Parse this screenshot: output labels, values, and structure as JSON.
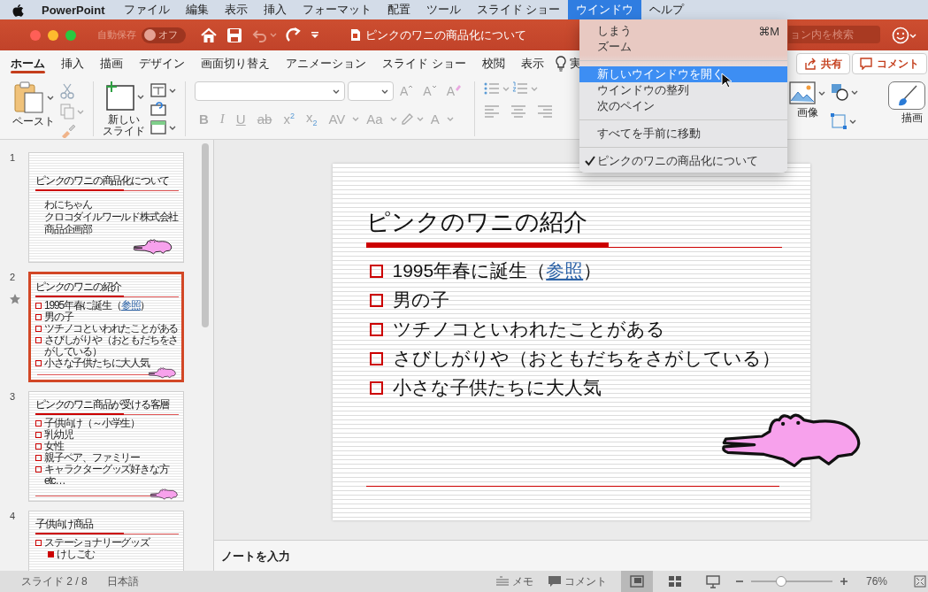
{
  "menubar": {
    "app_name": "PowerPoint",
    "menus": [
      {
        "label": "ファイル",
        "selected": false
      },
      {
        "label": "編集",
        "selected": false
      },
      {
        "label": "表示",
        "selected": false
      },
      {
        "label": "挿入",
        "selected": false
      },
      {
        "label": "フォーマット",
        "selected": false
      },
      {
        "label": "配置",
        "selected": false
      },
      {
        "label": "ツール",
        "selected": false
      },
      {
        "label": "スライド ショー",
        "selected": false
      },
      {
        "label": "ウインドウ",
        "selected": true
      },
      {
        "label": "ヘルプ",
        "selected": false
      }
    ]
  },
  "titlebar": {
    "autosave_label": "自動保存",
    "autosave_toggle": {
      "label": "オフ",
      "on": false
    },
    "document_title": "ピンクのワニの商品化について",
    "search": {
      "placeholder": "ョン内を検索"
    }
  },
  "ribbon_tabs": [
    {
      "label": "ホーム",
      "selected": true
    },
    {
      "label": "挿入",
      "selected": false
    },
    {
      "label": "描画",
      "selected": false
    },
    {
      "label": "デザイン",
      "selected": false
    },
    {
      "label": "画面切り替え",
      "selected": false
    },
    {
      "label": "アニメーション",
      "selected": false
    },
    {
      "label": "スライド ショー",
      "selected": false
    },
    {
      "label": "校閲",
      "selected": false
    },
    {
      "label": "表示",
      "selected": false
    }
  ],
  "tell_me": {
    "label": "実"
  },
  "share_button": "共有",
  "comments_button": "コメント",
  "ribbon": {
    "paste_label": "ペースト",
    "new_slide_label": [
      "新しい",
      "スライド"
    ],
    "font_tools": [
      {
        "kind": "grow",
        "label": "A"
      },
      {
        "kind": "shrink",
        "label": "A"
      },
      {
        "kind": "clear",
        "label": "A"
      }
    ],
    "format_buttons": [
      {
        "kind": "bold",
        "label": "B"
      },
      {
        "kind": "italic",
        "label": "I"
      },
      {
        "kind": "underline",
        "label": "U"
      },
      {
        "kind": "strike",
        "label": "ab"
      },
      {
        "kind": "superscript",
        "label": "x$^{2}$"
      },
      {
        "kind": "subscript",
        "label": "x$_{2}$"
      },
      {
        "kind": "spacing",
        "label": "AV"
      },
      {
        "kind": "case",
        "label": "Aa"
      }
    ],
    "font_color_label": "A",
    "picture_label": "画像",
    "draw_label": "描画"
  },
  "window_menu": {
    "items": [
      {
        "kind": "item",
        "label": "しまう",
        "shortcut": "⌘M",
        "selected": false,
        "checked": false
      },
      {
        "kind": "item",
        "label": "ズーム",
        "selected": false,
        "checked": false
      },
      {
        "kind": "separator"
      },
      {
        "kind": "item",
        "label": "新しいウインドウを開く",
        "selected": true,
        "checked": false
      },
      {
        "kind": "item",
        "label": "ウインドウの整列",
        "selected": false,
        "checked": false
      },
      {
        "kind": "item",
        "label": "次のペイン",
        "selected": false,
        "checked": false
      },
      {
        "kind": "separator"
      },
      {
        "kind": "item",
        "label": "すべてを手前に移動",
        "selected": false,
        "checked": false
      },
      {
        "kind": "separator"
      },
      {
        "kind": "item",
        "label": "ピンクのワニの商品化について",
        "selected": false,
        "checked": true
      }
    ]
  },
  "thumbnails": [
    {
      "number": "1",
      "selected": false,
      "starred": false,
      "kind": "title",
      "title": "ピンクのワニの商品化について",
      "lines": [
        "わにちゃん",
        "クロコダイルワールド株式会社",
        "商品企画部"
      ]
    },
    {
      "number": "2",
      "selected": true,
      "starred": true,
      "kind": "bullets",
      "title": "ピンクのワニの紹介",
      "bullets": [
        {
          "text": "1995年春に誕生（",
          "link": "参照",
          "tail": "）"
        },
        {
          "text": "男の子"
        },
        {
          "text": "ツチノコといわれたことがある"
        },
        {
          "text": "さびしがりや（おともだちをさがしている）"
        },
        {
          "text": "小さな子供たちに大人気"
        }
      ]
    },
    {
      "number": "3",
      "selected": false,
      "starred": false,
      "kind": "bullets",
      "title": "ピンクのワニ商品が受ける客層",
      "bullets": [
        {
          "text": "子供向け（～小学生）"
        },
        {
          "text": "乳幼児"
        },
        {
          "text": "女性"
        },
        {
          "text": "親子ペア、ファミリー"
        },
        {
          "text": "キャラクターグッズ好きな方 etc…"
        }
      ]
    },
    {
      "number": "4",
      "selected": false,
      "starred": false,
      "kind": "bullets",
      "title": "子供向け商品",
      "bullets": [
        {
          "text": "ステーショナリーグッズ",
          "children": [
            {
              "text": "けしごむ"
            }
          ]
        }
      ]
    }
  ],
  "slide": {
    "title": "ピンクのワニの紹介",
    "bullets": [
      {
        "text": "1995年春に誕生（",
        "link": "参照",
        "tail": "）"
      },
      {
        "text": "男の子"
      },
      {
        "text": "ツチノコといわれたことがある"
      },
      {
        "text": "さびしがりや（おともだちをさがしている）"
      },
      {
        "text": "小さな子供たちに大人気"
      }
    ]
  },
  "notes": {
    "placeholder": "ノートを入力"
  },
  "statusbar": {
    "slide_counter": "スライド 2 / 8",
    "language": "日本語",
    "notes_button": "メモ",
    "comments_button": "コメント",
    "views": [
      {
        "kind": "normal",
        "selected": true
      },
      {
        "kind": "sorter",
        "selected": false
      },
      {
        "kind": "reading",
        "selected": false
      }
    ],
    "zoom": {
      "level": 0.37,
      "reading": "76%"
    }
  }
}
